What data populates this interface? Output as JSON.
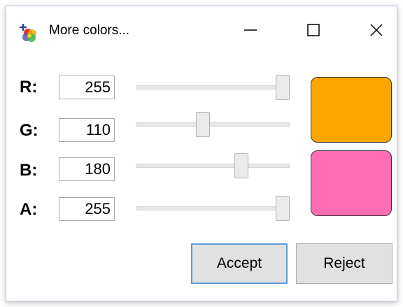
{
  "window": {
    "title": "More colors...",
    "icons": {
      "app": "color-palette-icon",
      "minimize": "minimize-icon",
      "maximize": "maximize-icon",
      "close": "close-icon"
    }
  },
  "channels": [
    {
      "label": "R:",
      "value": "255",
      "min": 0,
      "max": 255,
      "level": 255
    },
    {
      "label": "G:",
      "value": "110",
      "min": 0,
      "max": 255,
      "level": 110
    },
    {
      "label": "B:",
      "value": "180",
      "min": 0,
      "max": 255,
      "level": 180
    },
    {
      "label": "A:",
      "value": "255",
      "min": 0,
      "max": 255,
      "level": 255
    }
  ],
  "swatches": {
    "previous_color": "#FFA500",
    "new_color": "#FF6EB4"
  },
  "buttons": {
    "accept": "Accept",
    "reject": "Reject"
  }
}
